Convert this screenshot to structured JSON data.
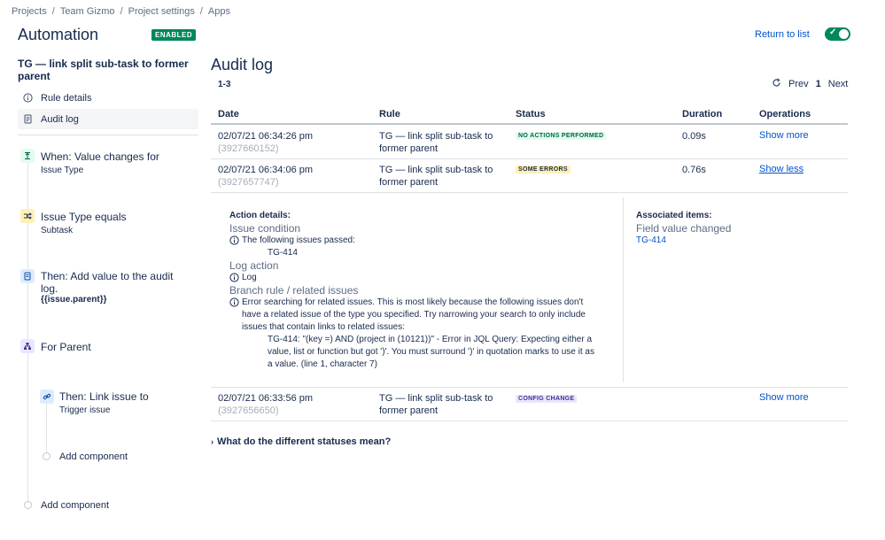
{
  "breadcrumbs": [
    "Projects",
    "Team Gizmo",
    "Project settings",
    "Apps"
  ],
  "header": {
    "title": "Automation",
    "badge": "ENABLED",
    "return_label": "Return to list",
    "toggle_on": true
  },
  "sidebar": {
    "rule_title": "TG — link split sub-task to former parent",
    "items": [
      {
        "label": "Rule details",
        "icon": "info-icon"
      },
      {
        "label": "Audit log",
        "icon": "document-icon",
        "active": true
      }
    ],
    "steps": {
      "trigger": {
        "title": "When: Value changes for",
        "sub": "Issue Type",
        "icon": "trigger-icon"
      },
      "condition": {
        "title": "Issue Type equals",
        "sub": "Subtask",
        "icon": "shuffle-icon"
      },
      "action": {
        "title": "Then: Add value to the audit log.",
        "sub": "{{issue.parent}}",
        "icon": "log-icon"
      },
      "branch": {
        "title": "For Parent",
        "icon": "hierarchy-icon"
      },
      "branch_action": {
        "title": "Then: Link issue to",
        "sub": "Trigger issue",
        "icon": "link-icon"
      },
      "add_inner": "Add component",
      "add_outer": "Add component"
    }
  },
  "audit": {
    "title": "Audit log",
    "range": "1-3",
    "pager": {
      "prev": "Prev",
      "current": "1",
      "next": "Next"
    },
    "columns": [
      "Date",
      "Rule",
      "Status",
      "Duration",
      "Operations"
    ],
    "rows": [
      {
        "date": "02/07/21 06:34:26 pm",
        "id": "(3927660152)",
        "rule": [
          "TG — link split sub-task to",
          "former parent"
        ],
        "status": "NO ACTIONS PERFORMED",
        "duration": "0.09s",
        "op": "Show more"
      },
      {
        "date": "02/07/21 06:34:06 pm",
        "id": "(3927657747)",
        "rule": [
          "TG — link split sub-task to",
          "former parent"
        ],
        "status": "SOME ERRORS",
        "duration": "0.76s",
        "op": "Show less"
      },
      {
        "date": "02/07/21 06:33:56 pm",
        "id": "(3927656650)",
        "rule": [
          "TG — link split sub-task to",
          "former parent"
        ],
        "status": "CONFIG CHANGE",
        "duration": "",
        "op": "Show more"
      }
    ],
    "details": {
      "label": "Action details:",
      "issue_condition": "Issue condition",
      "passed": "The following issues passed:",
      "passed_issue": "TG-414",
      "log_action": "Log action",
      "log": "Log",
      "branch": "Branch rule / related issues",
      "error_lines": [
        "Error searching for related issues. This is most likely because the following issues don't",
        "have a related issue of the type you specified. Try narrowing your search to only include",
        "issues that contain links to related issues:"
      ],
      "error_detail_lines": [
        "TG-414: \"(key =) AND (project in (10121))\" - Error in JQL Query: Expecting either a",
        "value, list or function but got ')'. You must surround ')' in quotation marks to use it as",
        "a value. (line 1, character 7)"
      ],
      "assoc_label": "Associated items:",
      "assoc_sect": "Field value changed",
      "assoc_link": "TG-414"
    },
    "faq": "What do the different statuses mean?"
  },
  "colors": {
    "green": "#00875a",
    "link": "#0052cc",
    "text": "#172b4d"
  }
}
